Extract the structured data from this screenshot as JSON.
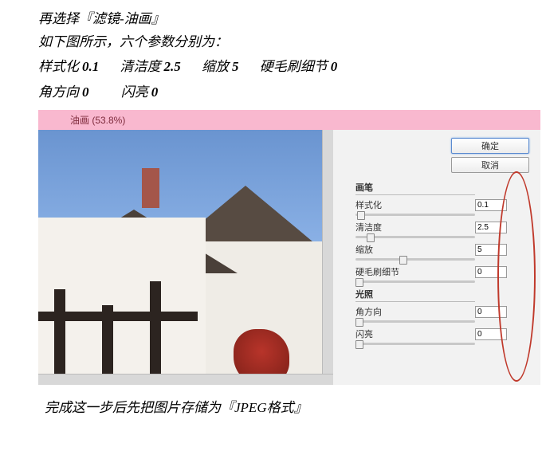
{
  "instructions": {
    "line1": "再选择『滤镜-油画』",
    "line2": "如下图所示，六个参数分别为："
  },
  "summary_params": [
    {
      "label": "样式化",
      "value": "0.1"
    },
    {
      "label": "清洁度",
      "value": "2.5"
    },
    {
      "label": "缩放",
      "value": "5"
    },
    {
      "label": "硬毛刷细节",
      "value": "0"
    },
    {
      "label": "角方向",
      "value": "0"
    },
    {
      "label": "闪亮",
      "value": "0"
    }
  ],
  "dialog": {
    "title": "油画 (53.8%)",
    "buttons": {
      "ok": "确定",
      "cancel": "取消"
    },
    "groups": {
      "brush": {
        "title": "画笔",
        "params": [
          {
            "label": "样式化",
            "value": "0.1",
            "pos": 2
          },
          {
            "label": "清洁度",
            "value": "2.5",
            "pos": 12
          },
          {
            "label": "缩放",
            "value": "5",
            "pos": 40
          },
          {
            "label": "硬毛刷细节",
            "value": "0",
            "pos": 0
          }
        ]
      },
      "light": {
        "title": "光照",
        "params": [
          {
            "label": "角方向",
            "value": "0",
            "pos": 0
          },
          {
            "label": "闪亮",
            "value": "0",
            "pos": 0
          }
        ]
      }
    }
  },
  "footer": "完成这一步后先把图片存储为『JPEG格式』"
}
